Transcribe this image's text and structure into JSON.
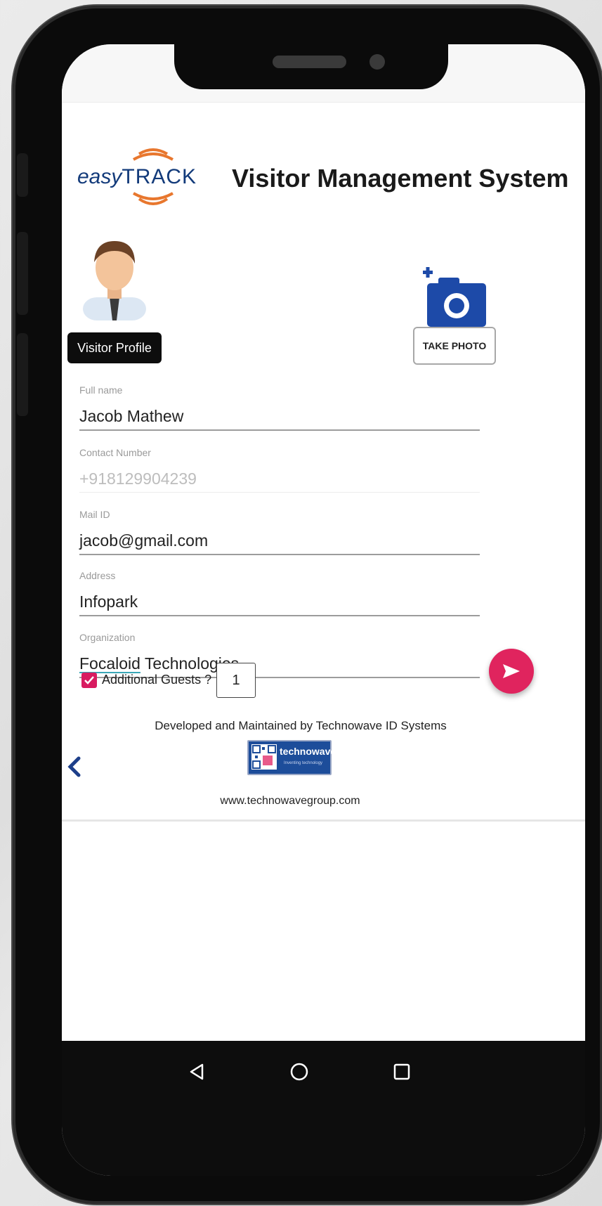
{
  "app": {
    "logo_text_easy": "easy",
    "logo_text_track": "TRACK",
    "title": "Visitor Management System"
  },
  "profile": {
    "tag_label": "Visitor Profile",
    "take_photo_label": "TAKE PHOTO"
  },
  "form": {
    "fields": [
      {
        "label": "Full name",
        "value": "Jacob Mathew"
      },
      {
        "label": "Contact Number",
        "value": "+918129904239"
      },
      {
        "label": "Mail ID",
        "value": "jacob@gmail.com"
      },
      {
        "label": "Address",
        "value": "Infopark"
      },
      {
        "label": "Organization",
        "value_part1": "Focaloid",
        "value_part2": " Technologies"
      }
    ],
    "additional_guests_label": "Additional Guests ?",
    "additional_guests_checked": true,
    "additional_guests_count": "1"
  },
  "footer": {
    "developer_text": "Developed and Maintained by Technowave ID Systems",
    "brand_name": "technowave",
    "brand_tagline": "Inventing technology",
    "website": "www.technowavegroup.com"
  },
  "colors": {
    "accent": "#e0245e",
    "checkbox": "#d81b60",
    "logo_orange": "#e8772e",
    "logo_blue": "#123a7a",
    "camera_blue": "#1d4aa8"
  },
  "icons": {
    "submit": "send-icon",
    "back": "chevron-left-icon",
    "camera": "add-camera-icon",
    "nav_back": "triangle-back-icon",
    "nav_home": "circle-home-icon",
    "nav_recents": "square-recents-icon"
  }
}
